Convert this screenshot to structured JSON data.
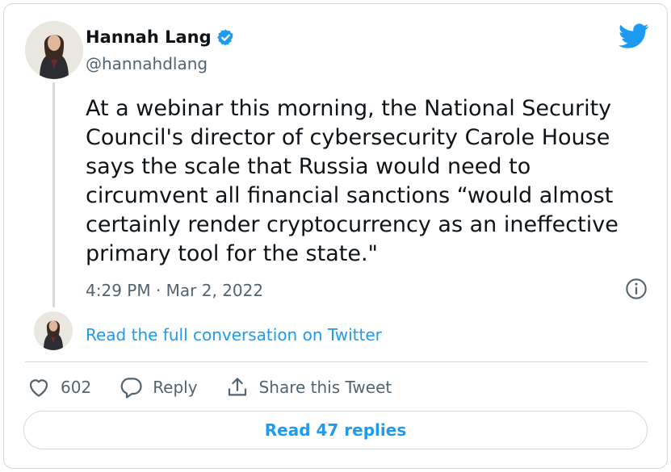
{
  "author": {
    "display_name": "Hannah Lang",
    "handle": "@hannahdlang",
    "verified": true
  },
  "tweet": {
    "text": "At a webinar this morning, the National Security Council's director of cybersecurity Carole House says the scale that Russia would need to circumvent all financial sanctions “would almost certainly render cryptocurrency as an ineffective primary tool for the state.\"",
    "timestamp": "4:29 PM · Mar 2, 2022"
  },
  "conversation_link": "Read the full conversation on Twitter",
  "actions": {
    "likes_count": "602",
    "reply_label": "Reply",
    "share_label": "Share this Tweet"
  },
  "read_replies_label": "Read 47 replies",
  "colors": {
    "accent": "#1d9bf0",
    "secondary_text": "#536471",
    "border": "#cfd9de"
  },
  "icons": [
    "verified-badge-icon",
    "twitter-bird-icon",
    "info-icon",
    "heart-icon",
    "reply-icon",
    "share-icon"
  ]
}
